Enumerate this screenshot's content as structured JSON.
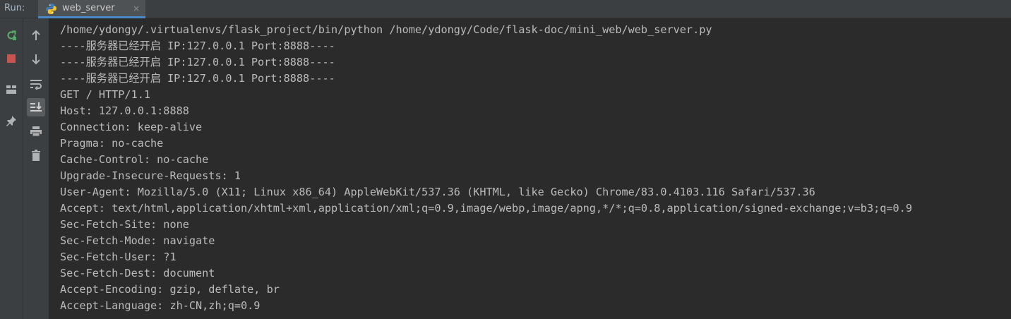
{
  "run_panel": {
    "label": "Run:",
    "tab": {
      "title": "web_server",
      "close_symbol": "×",
      "icon": "python-icon"
    }
  },
  "toolbar_left": [
    {
      "name": "rerun-icon",
      "color": "#59a869"
    },
    {
      "name": "stop-icon",
      "color": "#c75450"
    },
    {
      "name": "layout-icon"
    },
    {
      "name": "pin-icon"
    }
  ],
  "toolbar_right": [
    {
      "name": "arrow-up-icon"
    },
    {
      "name": "arrow-down-icon"
    },
    {
      "name": "soft-wrap-icon"
    },
    {
      "name": "scroll-to-end-icon",
      "active": true
    },
    {
      "name": "print-icon"
    },
    {
      "name": "trash-icon"
    }
  ],
  "console": {
    "lines": [
      "/home/ydongy/.virtualenvs/flask_project/bin/python /home/ydongy/Code/flask-doc/mini_web/web_server.py",
      "----服务器已经开启 IP:127.0.0.1 Port:8888----",
      "----服务器已经开启 IP:127.0.0.1 Port:8888----",
      "----服务器已经开启 IP:127.0.0.1 Port:8888----",
      "GET / HTTP/1.1",
      "Host: 127.0.0.1:8888",
      "Connection: keep-alive",
      "Pragma: no-cache",
      "Cache-Control: no-cache",
      "Upgrade-Insecure-Requests: 1",
      "User-Agent: Mozilla/5.0 (X11; Linux x86_64) AppleWebKit/537.36 (KHTML, like Gecko) Chrome/83.0.4103.116 Safari/537.36",
      "Accept: text/html,application/xhtml+xml,application/xml;q=0.9,image/webp,image/apng,*/*;q=0.8,application/signed-exchange;v=b3;q=0.9",
      "Sec-Fetch-Site: none",
      "Sec-Fetch-Mode: navigate",
      "Sec-Fetch-User: ?1",
      "Sec-Fetch-Dest: document",
      "Accept-Encoding: gzip, deflate, br",
      "Accept-Language: zh-CN,zh;q=0.9"
    ],
    "text_color": "#bbbbbb",
    "background": "#2b2b2b"
  }
}
